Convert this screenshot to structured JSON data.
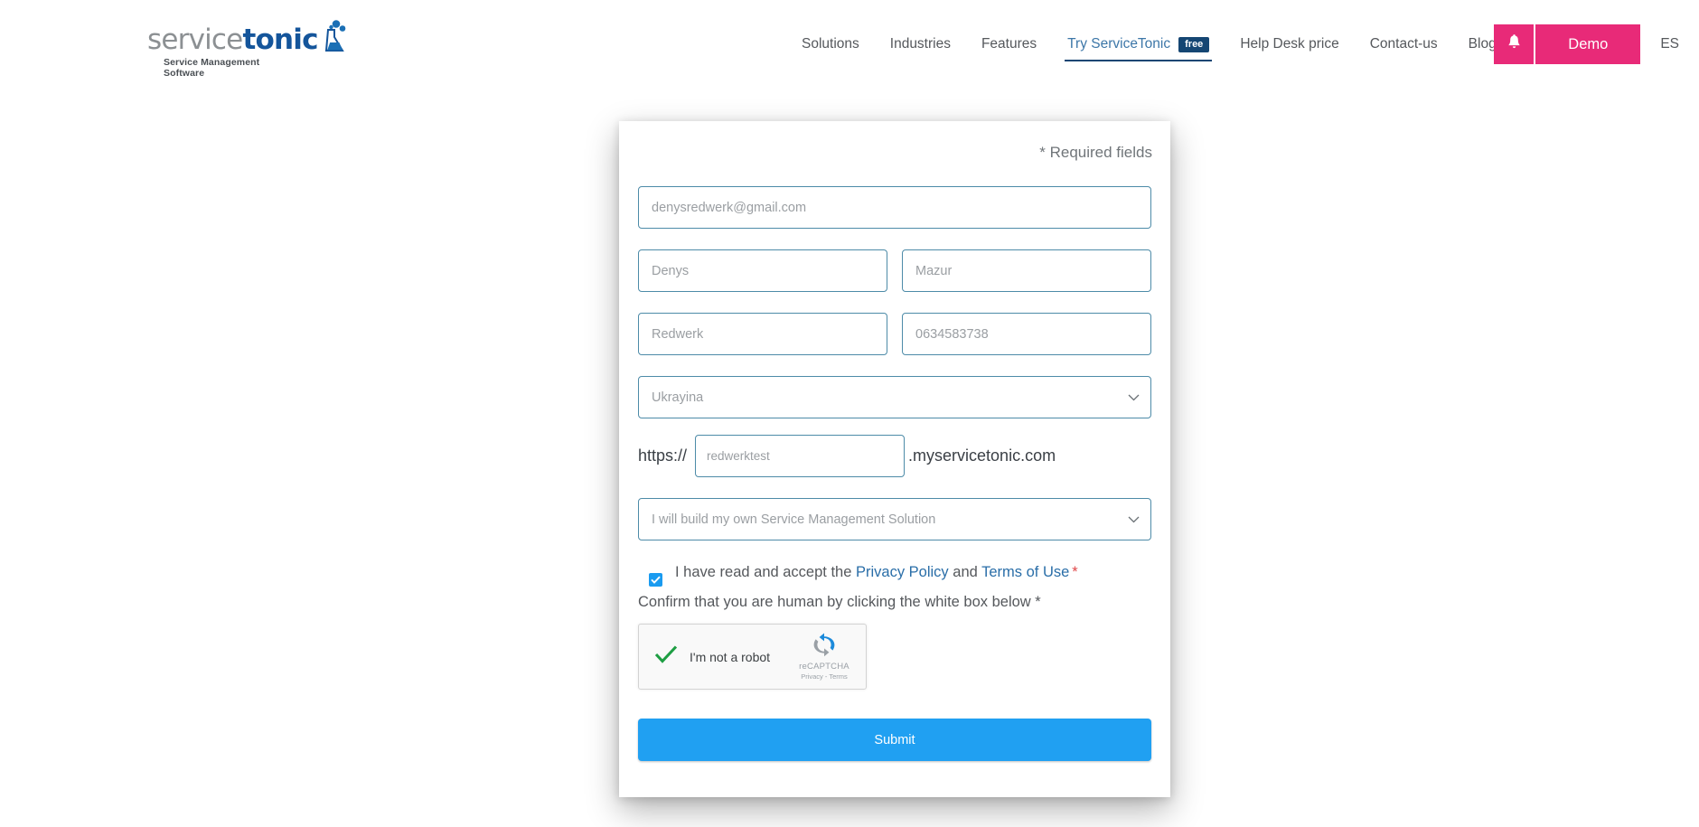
{
  "brand": {
    "logo_primary": "service",
    "logo_secondary": "tonic",
    "logo_tagline": "Service Management Software",
    "accent_pink": "#e82a78",
    "accent_blue": "#20a0f2",
    "nav_navy": "#154673",
    "field_border": "#4d8ba8"
  },
  "nav": {
    "items": [
      {
        "label": "Solutions",
        "active": false
      },
      {
        "label": "Industries",
        "active": false
      },
      {
        "label": "Features",
        "active": false
      },
      {
        "label": "Try ServiceTonic",
        "active": true,
        "badge": "free"
      },
      {
        "label": "Help Desk price",
        "active": false
      },
      {
        "label": "Contact-us",
        "active": false
      },
      {
        "label": "Blog",
        "active": false
      }
    ],
    "notifications_icon": "bell-icon",
    "demo_label": "Demo",
    "language_label": "ES"
  },
  "form": {
    "required_note": "* Required fields",
    "email_placeholder": "denysredwerk@gmail.com",
    "email_value": "",
    "first_name_placeholder": "Denys",
    "first_name_value": "",
    "last_name_placeholder": "Mazur",
    "last_name_value": "",
    "company_placeholder": "Redwerk",
    "company_value": "",
    "phone_placeholder": "0634583738",
    "phone_value": "",
    "country_selected": "Ukrayina",
    "country_options": [
      "Ukrayina"
    ],
    "domain_prefix": "https://",
    "domain_placeholder": "redwerktest",
    "domain_value": "",
    "domain_suffix": ".myservicetonic.com",
    "solution_selected": "I will build my own Service Management Solution",
    "solution_options": [
      "I will build my own Service Management Solution"
    ],
    "consent_prefix": "I have read and accept the",
    "privacy_policy_label": "Privacy Policy",
    "consent_conjunction": "and",
    "terms_label": "Terms of Use",
    "consent_required_mark": "*",
    "consent_checked": true,
    "human_label": "Confirm that you are human by clicking the white box below *",
    "submit_label": "Submit"
  },
  "recaptcha": {
    "label": "I'm not a robot",
    "brand_name": "reCAPTCHA",
    "legal": "Privacy - Terms",
    "verified": true,
    "check_icon": "green-check-icon",
    "logo_icon": "recaptcha-logo-icon"
  }
}
